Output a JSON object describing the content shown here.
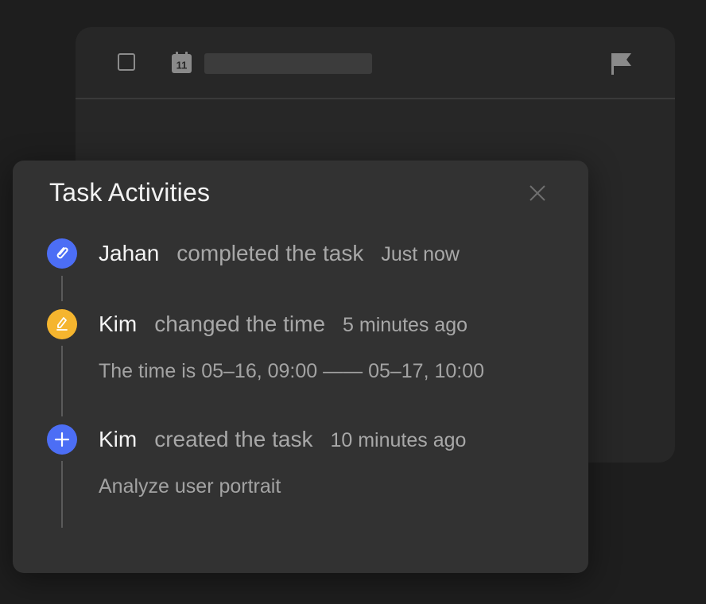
{
  "task_card": {
    "flag_icon": "flag-icon",
    "calendar_icon": "calendar-icon",
    "calendar_day": "11"
  },
  "activities_panel": {
    "title": "Task Activities",
    "close_icon": "close-icon",
    "items": [
      {
        "icon": "link-icon",
        "color": "#4c6ef5",
        "actor": "Jahan",
        "action": "completed the task",
        "time": "Just now",
        "detail": ""
      },
      {
        "icon": "edit-icon",
        "color": "#f5b52e",
        "actor": "Kim",
        "action": "changed the time",
        "time": "5 minutes ago",
        "detail": "The time is 05–16, 09:00 —— 05–17,  10:00"
      },
      {
        "icon": "plus-icon",
        "color": "#4c6ef5",
        "actor": "Kim",
        "action": "created the task",
        "time": "10 minutes ago",
        "detail": "Analyze user portrait"
      }
    ]
  }
}
